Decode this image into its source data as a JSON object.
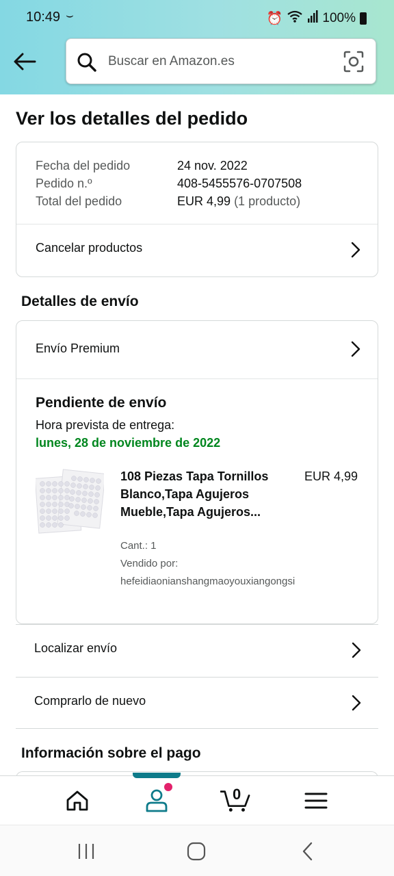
{
  "status_bar": {
    "time": "10:49",
    "battery": "100%"
  },
  "search": {
    "placeholder": "Buscar en Amazon.es"
  },
  "page": {
    "title": "Ver los detalles del pedido"
  },
  "order": {
    "date_label": "Fecha del pedido",
    "date_value": "24 nov. 2022",
    "number_label": "Pedido n.º",
    "number_value": "408-5455576-0707508",
    "total_label": "Total del pedido",
    "total_value": "EUR 4,99",
    "total_note": "(1 producto)",
    "cancel_label": "Cancelar productos"
  },
  "shipping": {
    "section_title": "Detalles de envío",
    "premium_label": "Envío Premium",
    "status": "Pendiente de envío",
    "eta_label": "Hora prevista de entrega:",
    "eta_date": "lunes, 28 de noviembre de 2022",
    "product": {
      "title": "108 Piezas Tapa Tornillos Blanco,Tapa Agujeros Mueble,Tapa Agujeros...",
      "price": "EUR 4,99",
      "qty": "Cant.: 1",
      "sold_by_label": "Vendido por:",
      "seller": "hefeidiaonianshangmaoyouxiangongsi"
    }
  },
  "actions": {
    "track_label": "Localizar envío",
    "buy_again_label": "Comprarlo de nuevo"
  },
  "payment": {
    "section_title": "Información sobre el pago"
  },
  "bottom_nav": {
    "items": [
      "home-icon",
      "account-icon",
      "cart-icon",
      "menu-icon"
    ],
    "cart_count": "0",
    "active": "account",
    "accent_color": "#0e7b8a",
    "notification_color": "#e3216b"
  },
  "colors": {
    "eta_green": "#00861e",
    "header_gradient_start": "#84d8e3",
    "header_gradient_end": "#a8e6cf"
  }
}
